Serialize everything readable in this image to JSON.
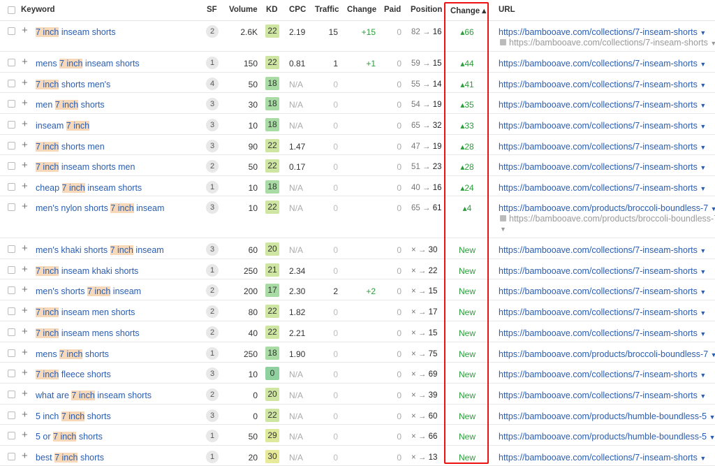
{
  "headers": {
    "keyword": "Keyword",
    "sf": "SF",
    "volume": "Volume",
    "kd": "KD",
    "cpc": "CPC",
    "traffic": "Traffic",
    "change": "Change",
    "paid": "Paid",
    "position": "Position",
    "change_sorted": "Change ▴",
    "url": "URL"
  },
  "colors": {
    "accent_red": "#e11111",
    "link": "#2a5db0",
    "positive": "#2a9d3a",
    "highlight": "#f7d9b9"
  },
  "rows": [
    {
      "kw_pre": "",
      "kw_hl": "7 inch",
      "kw_post": " inseam shorts",
      "sf": "2",
      "volume": "2.6K",
      "kd": "22",
      "cpc": "2.19",
      "traffic": "15",
      "change": "+15",
      "paid": "0",
      "pos_from": "82",
      "pos_to": "16",
      "change2": "▴66",
      "url": "https://bambooave.com/collections/7-inseam-shorts",
      "url2": "https://bambooave.com/collections/7-inseam-shorts"
    },
    {
      "kw_pre": "mens ",
      "kw_hl": "7 inch",
      "kw_post": " inseam shorts",
      "sf": "1",
      "volume": "150",
      "kd": "22",
      "cpc": "0.81",
      "traffic": "1",
      "change": "+1",
      "paid": "0",
      "pos_from": "59",
      "pos_to": "15",
      "change2": "▴44",
      "url": "https://bambooave.com/collections/7-inseam-shorts",
      "url2": ""
    },
    {
      "kw_pre": "",
      "kw_hl": "7 inch",
      "kw_post": " shorts men's",
      "sf": "4",
      "volume": "50",
      "kd": "18",
      "cpc": "N/A",
      "traffic": "0",
      "change": "",
      "paid": "0",
      "pos_from": "55",
      "pos_to": "14",
      "change2": "▴41",
      "url": "https://bambooave.com/collections/7-inseam-shorts",
      "url2": ""
    },
    {
      "kw_pre": "men ",
      "kw_hl": "7 inch",
      "kw_post": " shorts",
      "sf": "3",
      "volume": "30",
      "kd": "18",
      "cpc": "N/A",
      "traffic": "0",
      "change": "",
      "paid": "0",
      "pos_from": "54",
      "pos_to": "19",
      "change2": "▴35",
      "url": "https://bambooave.com/collections/7-inseam-shorts",
      "url2": ""
    },
    {
      "kw_pre": "inseam ",
      "kw_hl": "7 inch",
      "kw_post": "",
      "sf": "3",
      "volume": "10",
      "kd": "18",
      "cpc": "N/A",
      "traffic": "0",
      "change": "",
      "paid": "0",
      "pos_from": "65",
      "pos_to": "32",
      "change2": "▴33",
      "url": "https://bambooave.com/collections/7-inseam-shorts",
      "url2": ""
    },
    {
      "kw_pre": "",
      "kw_hl": "7 inch",
      "kw_post": " shorts men",
      "sf": "3",
      "volume": "90",
      "kd": "22",
      "cpc": "1.47",
      "traffic": "0",
      "change": "",
      "paid": "0",
      "pos_from": "47",
      "pos_to": "19",
      "change2": "▴28",
      "url": "https://bambooave.com/collections/7-inseam-shorts",
      "url2": ""
    },
    {
      "kw_pre": "",
      "kw_hl": "7 inch",
      "kw_post": " inseam shorts men",
      "sf": "2",
      "volume": "50",
      "kd": "22",
      "cpc": "0.17",
      "traffic": "0",
      "change": "",
      "paid": "0",
      "pos_from": "51",
      "pos_to": "23",
      "change2": "▴28",
      "url": "https://bambooave.com/collections/7-inseam-shorts",
      "url2": ""
    },
    {
      "kw_pre": "cheap ",
      "kw_hl": "7 inch",
      "kw_post": " inseam shorts",
      "sf": "1",
      "volume": "10",
      "kd": "18",
      "cpc": "N/A",
      "traffic": "0",
      "change": "",
      "paid": "0",
      "pos_from": "40",
      "pos_to": "16",
      "change2": "▴24",
      "url": "https://bambooave.com/collections/7-inseam-shorts",
      "url2": ""
    },
    {
      "kw_pre": "men's nylon shorts ",
      "kw_hl": "7 inch",
      "kw_post": " inseam",
      "sf": "3",
      "volume": "10",
      "kd": "22",
      "cpc": "N/A",
      "traffic": "0",
      "change": "",
      "paid": "0",
      "pos_from": "65",
      "pos_to": "61",
      "change2": "▴4",
      "url": "https://bambooave.com/products/broccoli-boundless-7",
      "url2": "https://bambooave.com/products/broccoli-boundless-7"
    },
    {
      "kw_pre": "men's khaki shorts ",
      "kw_hl": "7 inch",
      "kw_post": " inseam",
      "sf": "3",
      "volume": "60",
      "kd": "20",
      "cpc": "N/A",
      "traffic": "0",
      "change": "",
      "paid": "0",
      "pos_from": "×",
      "pos_to": "30",
      "change2": "New",
      "url": "https://bambooave.com/collections/7-inseam-shorts",
      "url2": ""
    },
    {
      "kw_pre": "",
      "kw_hl": "7 inch",
      "kw_post": " inseam khaki shorts",
      "sf": "1",
      "volume": "250",
      "kd": "21",
      "cpc": "2.34",
      "traffic": "0",
      "change": "",
      "paid": "0",
      "pos_from": "×",
      "pos_to": "22",
      "change2": "New",
      "url": "https://bambooave.com/collections/7-inseam-shorts",
      "url2": ""
    },
    {
      "kw_pre": "men's shorts ",
      "kw_hl": "7 inch",
      "kw_post": " inseam",
      "sf": "2",
      "volume": "200",
      "kd": "17",
      "cpc": "2.30",
      "traffic": "2",
      "change": "+2",
      "paid": "0",
      "pos_from": "×",
      "pos_to": "15",
      "change2": "New",
      "url": "https://bambooave.com/collections/7-inseam-shorts",
      "url2": ""
    },
    {
      "kw_pre": "",
      "kw_hl": "7 inch",
      "kw_post": " inseam men shorts",
      "sf": "2",
      "volume": "80",
      "kd": "22",
      "cpc": "1.82",
      "traffic": "0",
      "change": "",
      "paid": "0",
      "pos_from": "×",
      "pos_to": "17",
      "change2": "New",
      "url": "https://bambooave.com/collections/7-inseam-shorts",
      "url2": ""
    },
    {
      "kw_pre": "",
      "kw_hl": "7 inch",
      "kw_post": " inseam mens shorts",
      "sf": "2",
      "volume": "40",
      "kd": "22",
      "cpc": "2.21",
      "traffic": "0",
      "change": "",
      "paid": "0",
      "pos_from": "×",
      "pos_to": "15",
      "change2": "New",
      "url": "https://bambooave.com/collections/7-inseam-shorts",
      "url2": ""
    },
    {
      "kw_pre": "mens ",
      "kw_hl": "7 inch",
      "kw_post": " shorts",
      "sf": "1",
      "volume": "250",
      "kd": "18",
      "cpc": "1.90",
      "traffic": "0",
      "change": "",
      "paid": "0",
      "pos_from": "×",
      "pos_to": "75",
      "change2": "New",
      "url": "https://bambooave.com/products/broccoli-boundless-7",
      "url2": ""
    },
    {
      "kw_pre": "",
      "kw_hl": "7 inch",
      "kw_post": " fleece shorts",
      "sf": "3",
      "volume": "10",
      "kd": "0",
      "cpc": "N/A",
      "traffic": "0",
      "change": "",
      "paid": "0",
      "pos_from": "×",
      "pos_to": "69",
      "change2": "New",
      "url": "https://bambooave.com/collections/7-inseam-shorts",
      "url2": ""
    },
    {
      "kw_pre": "what are ",
      "kw_hl": "7 inch",
      "kw_post": " inseam shorts",
      "sf": "2",
      "volume": "0",
      "kd": "20",
      "cpc": "N/A",
      "traffic": "0",
      "change": "",
      "paid": "0",
      "pos_from": "×",
      "pos_to": "39",
      "change2": "New",
      "url": "https://bambooave.com/collections/7-inseam-shorts",
      "url2": ""
    },
    {
      "kw_pre": "5 inch ",
      "kw_hl": "7 inch",
      "kw_post": " shorts",
      "sf": "3",
      "volume": "0",
      "kd": "22",
      "cpc": "N/A",
      "traffic": "0",
      "change": "",
      "paid": "0",
      "pos_from": "×",
      "pos_to": "60",
      "change2": "New",
      "url": "https://bambooave.com/products/humble-boundless-5",
      "url2": ""
    },
    {
      "kw_pre": "5 or ",
      "kw_hl": "7 inch",
      "kw_post": " shorts",
      "sf": "1",
      "volume": "50",
      "kd": "29",
      "cpc": "N/A",
      "traffic": "0",
      "change": "",
      "paid": "0",
      "pos_from": "×",
      "pos_to": "66",
      "change2": "New",
      "url": "https://bambooave.com/products/humble-boundless-5",
      "url2": ""
    },
    {
      "kw_pre": "best ",
      "kw_hl": "7 inch",
      "kw_post": " shorts",
      "sf": "1",
      "volume": "20",
      "kd": "30",
      "cpc": "N/A",
      "traffic": "0",
      "change": "",
      "paid": "0",
      "pos_from": "×",
      "pos_to": "13",
      "change2": "New",
      "url": "https://bambooave.com/collections/7-inseam-shorts",
      "url2": ""
    }
  ]
}
